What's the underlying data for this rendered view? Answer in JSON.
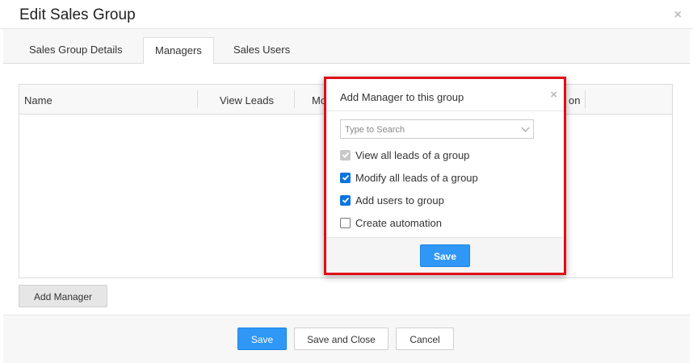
{
  "modal": {
    "title": "Edit Sales Group",
    "close": "×"
  },
  "tabs": [
    {
      "label": "Sales Group Details"
    },
    {
      "label": "Managers"
    },
    {
      "label": "Sales Users"
    }
  ],
  "grid": {
    "columns": [
      "Name",
      "View Leads",
      "Mo",
      "on"
    ]
  },
  "buttons": {
    "add_manager": "Add Manager",
    "save": "Save",
    "save_and_close": "Save and Close",
    "cancel": "Cancel"
  },
  "popup": {
    "title": "Add Manager to this group",
    "close": "×",
    "search_placeholder": "Type to Search",
    "options": [
      {
        "label": "View all leads of a group",
        "state": "checked-disabled"
      },
      {
        "label": "Modify all leads of a group",
        "state": "checked"
      },
      {
        "label": "Add users to group",
        "state": "checked"
      },
      {
        "label": "Create automation",
        "state": "unchecked"
      }
    ],
    "save": "Save"
  },
  "colors": {
    "accent": "#2f97f5",
    "highlight_border": "#e10e16",
    "checkbox": "#0b74e0"
  }
}
